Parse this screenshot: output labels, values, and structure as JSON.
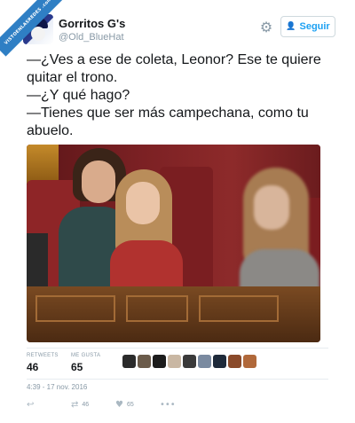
{
  "watermark": "VISTOENLASREDES .com",
  "tweet": {
    "author_name": "Gorritos G's",
    "author_handle": "@Old_BlueHat",
    "follow_label": "Seguir",
    "text_lines": [
      "—¿Ves a ese de coleta, Leonor? Ese te quiere",
      "quitar el trono.",
      "—¿Y qué hago?",
      "—Tienes que ser más campechana, como tu",
      "abuelo."
    ],
    "stats": {
      "retweets_label": "RETWEETS",
      "retweets_value": "46",
      "likes_label": "ME GUSTA",
      "likes_value": "65"
    },
    "liker_avatar_colors": [
      "#2b2b2b",
      "#6b5b4a",
      "#1c1c1c",
      "#c9b7a3",
      "#3a3a3a",
      "#7a8aa0",
      "#1e2a3a",
      "#8a4a2a",
      "#b0683a"
    ],
    "timestamp": "4:39 - 17 nov. 2016",
    "actions": {
      "retweet_count": "46",
      "like_count": "65"
    }
  },
  "icons": {
    "gear": "gear-icon",
    "follow": "add-user-icon",
    "reply": "reply-icon",
    "retweet": "retweet-icon",
    "like": "heart-icon",
    "more": "more-icon"
  },
  "colors": {
    "accent": "#1da1f2",
    "muted": "#8899a6"
  }
}
